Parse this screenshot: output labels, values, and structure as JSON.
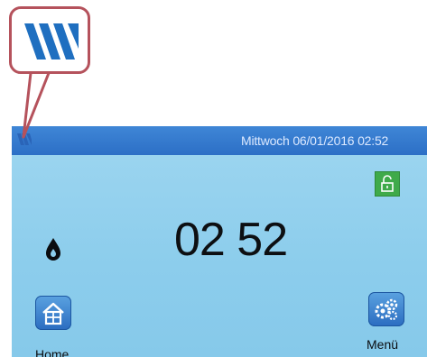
{
  "callout": {
    "logo_icon": "brand-stripes-logo"
  },
  "status_bar": {
    "datetime": "Mittwoch 06/01/2016  02:52"
  },
  "lock": {
    "icon": "unlock-icon"
  },
  "main": {
    "time": "02 52",
    "water_icon": "water-drop-icon"
  },
  "nav": {
    "home_label": "Home",
    "menu_label": "Menü"
  },
  "colors": {
    "screen_bg": "#8ccdec",
    "top_bar": "#2c6fc6",
    "lock_bg": "#3faa4a",
    "callout_border": "#b5525c",
    "logo_blue": "#1f6fc0"
  }
}
